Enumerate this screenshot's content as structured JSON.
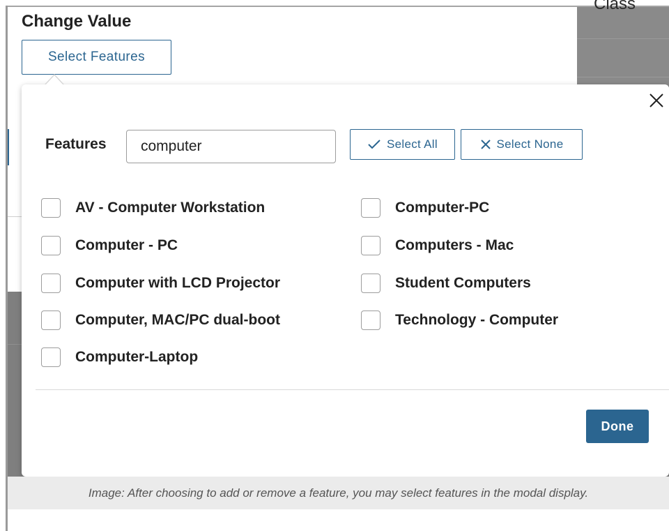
{
  "background": {
    "column_header": "Class"
  },
  "header": {
    "title": "Change Value",
    "select_features_label": "Select Features"
  },
  "modal": {
    "features_label": "Features",
    "search_value": "computer",
    "select_all_label": "Select All",
    "select_none_label": "Select None",
    "options_left": [
      {
        "label": "AV - Computer Workstation",
        "checked": false
      },
      {
        "label": "Computer - PC",
        "checked": false
      },
      {
        "label": "Computer with LCD Projector",
        "checked": false
      },
      {
        "label": "Computer, MAC/PC dual-boot",
        "checked": false
      },
      {
        "label": "Computer-Laptop",
        "checked": false
      }
    ],
    "options_right": [
      {
        "label": "Computer-PC",
        "checked": false
      },
      {
        "label": "Computers - Mac",
        "checked": false
      },
      {
        "label": "Student Computers",
        "checked": false
      },
      {
        "label": "Technology - Computer",
        "checked": false
      }
    ],
    "done_label": "Done"
  },
  "caption": "Image: After choosing to add or remove a feature, you may select features in the modal display.",
  "colors": {
    "accent": "#2b6590",
    "caption_bg": "#ebebeb",
    "overlay": "#7f7f7f"
  },
  "icons": {
    "close": "close-icon",
    "select_all": "check-icon",
    "select_none": "x-icon"
  }
}
